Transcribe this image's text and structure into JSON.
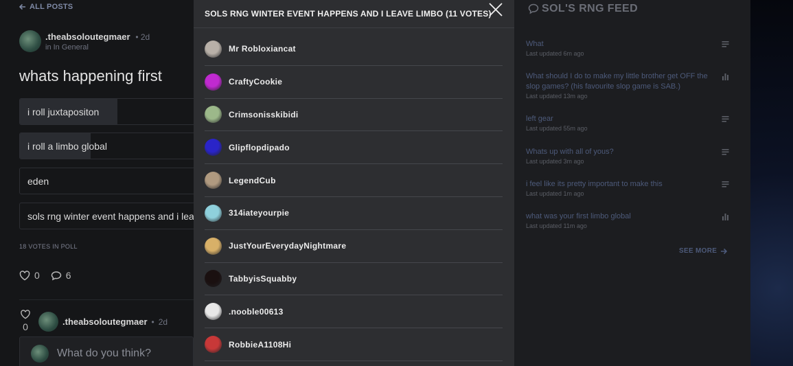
{
  "nav": {
    "back_label": "ALL POSTS"
  },
  "post": {
    "author": ".theabsoloutegmaer",
    "age": "2d",
    "category": "In General",
    "title": "whats happening first",
    "options": [
      {
        "label": "i roll juxtapositon",
        "percent": 55
      },
      {
        "label": "i roll a limbo global",
        "percent": 40
      },
      {
        "label": "eden",
        "percent": 0
      },
      {
        "label": "sols rng winter event happens and i leave limbo",
        "percent": 0
      }
    ],
    "votes_label": "18 VOTES IN POLL",
    "likes": "0",
    "comments": "6"
  },
  "reply": {
    "likes": "0",
    "author": ".theabsoloutegmaer",
    "age": "2d",
    "comment_placeholder": "What do you think?"
  },
  "modal": {
    "title": "SOLS RNG WINTER EVENT HAPPENS AND I LEAVE LIMBO (11 VOTES)",
    "voters": [
      {
        "name": "Mr Robloxiancat",
        "color": "#b8b0a8"
      },
      {
        "name": "CraftyCookie",
        "color": "#c02ad0"
      },
      {
        "name": "Crimsonisskibidi",
        "color": "#9cb88a"
      },
      {
        "name": "Glipflopdipado",
        "color": "#2a24c8"
      },
      {
        "name": "LegendCub",
        "color": "#b09a80"
      },
      {
        "name": "314iateyourpie",
        "color": "#8fd0dc"
      },
      {
        "name": "JustYourEverydayNightmare",
        "color": "#d8b068"
      },
      {
        "name": "TabbyisSquabby",
        "color": "#1a1010"
      },
      {
        "name": ".nooble00613",
        "color": "#e8e8e8"
      },
      {
        "name": "RobbieA1108Hi",
        "color": "#c83838"
      }
    ]
  },
  "feed": {
    "title": "SOL'S RNG FEED",
    "items": [
      {
        "title": "What",
        "time": "Last updated 6m ago",
        "icon": "text-icon"
      },
      {
        "title": "What should I do to make my little brother get OFF the slop games? (his favourite slop game is SAB.)",
        "time": "Last updated 13m ago",
        "icon": "poll-icon"
      },
      {
        "title": "left gear",
        "time": "Last updated 55m ago",
        "icon": "text-icon"
      },
      {
        "title": "Whats up with all of yous?",
        "time": "Last updated 3m ago",
        "icon": "text-icon"
      },
      {
        "title": "i feel like its pretty important to make this",
        "time": "Last updated 1m ago",
        "icon": "text-icon"
      },
      {
        "title": "what was your first limbo global",
        "time": "Last updated 11m ago",
        "icon": "poll-icon"
      }
    ],
    "see_more": "SEE MORE"
  }
}
